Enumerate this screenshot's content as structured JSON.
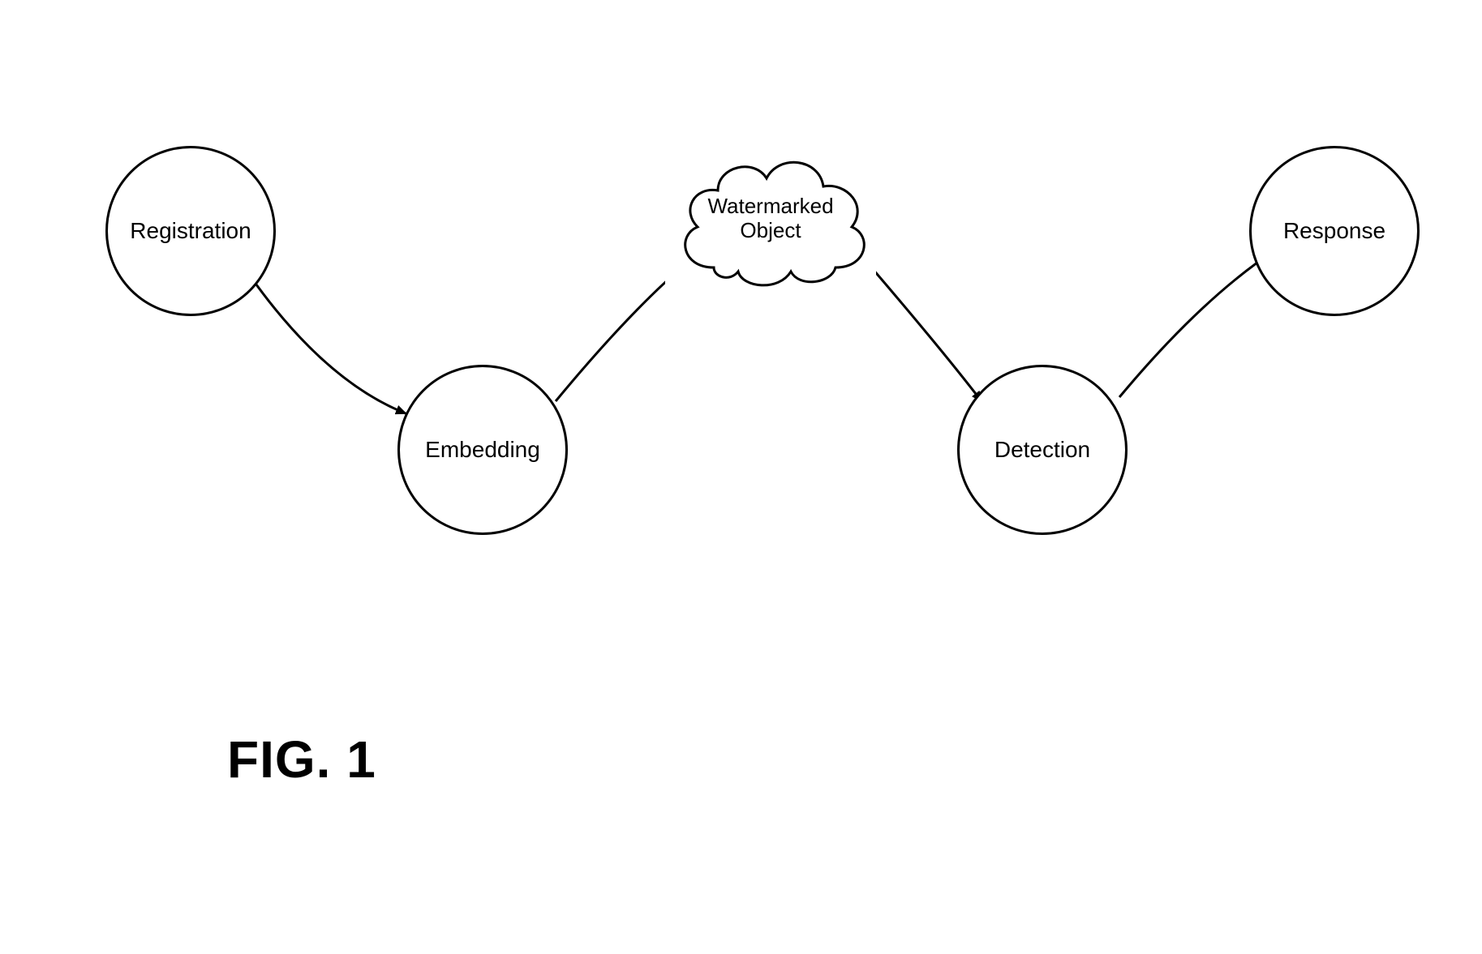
{
  "figure_caption": "FIG. 1",
  "nodes": {
    "registration": {
      "label": "Registration"
    },
    "embedding": {
      "label": "Embedding"
    },
    "watermarked": {
      "label_line1": "Watermarked",
      "label_line2": "Object"
    },
    "detection": {
      "label": "Detection"
    },
    "response": {
      "label": "Response"
    }
  },
  "flow": [
    "Registration → Embedding",
    "Embedding → Watermarked Object",
    "Watermarked Object → Detection",
    "Detection → Response"
  ],
  "chart_data": {
    "type": "flow-diagram",
    "nodes": [
      {
        "id": "registration",
        "label": "Registration",
        "shape": "circle"
      },
      {
        "id": "embedding",
        "label": "Embedding",
        "shape": "circle"
      },
      {
        "id": "watermarked",
        "label": "Watermarked Object",
        "shape": "cloud"
      },
      {
        "id": "detection",
        "label": "Detection",
        "shape": "circle"
      },
      {
        "id": "response",
        "label": "Response",
        "shape": "circle"
      }
    ],
    "edges": [
      {
        "from": "registration",
        "to": "embedding"
      },
      {
        "from": "embedding",
        "to": "watermarked"
      },
      {
        "from": "watermarked",
        "to": "detection"
      },
      {
        "from": "detection",
        "to": "response"
      }
    ]
  }
}
